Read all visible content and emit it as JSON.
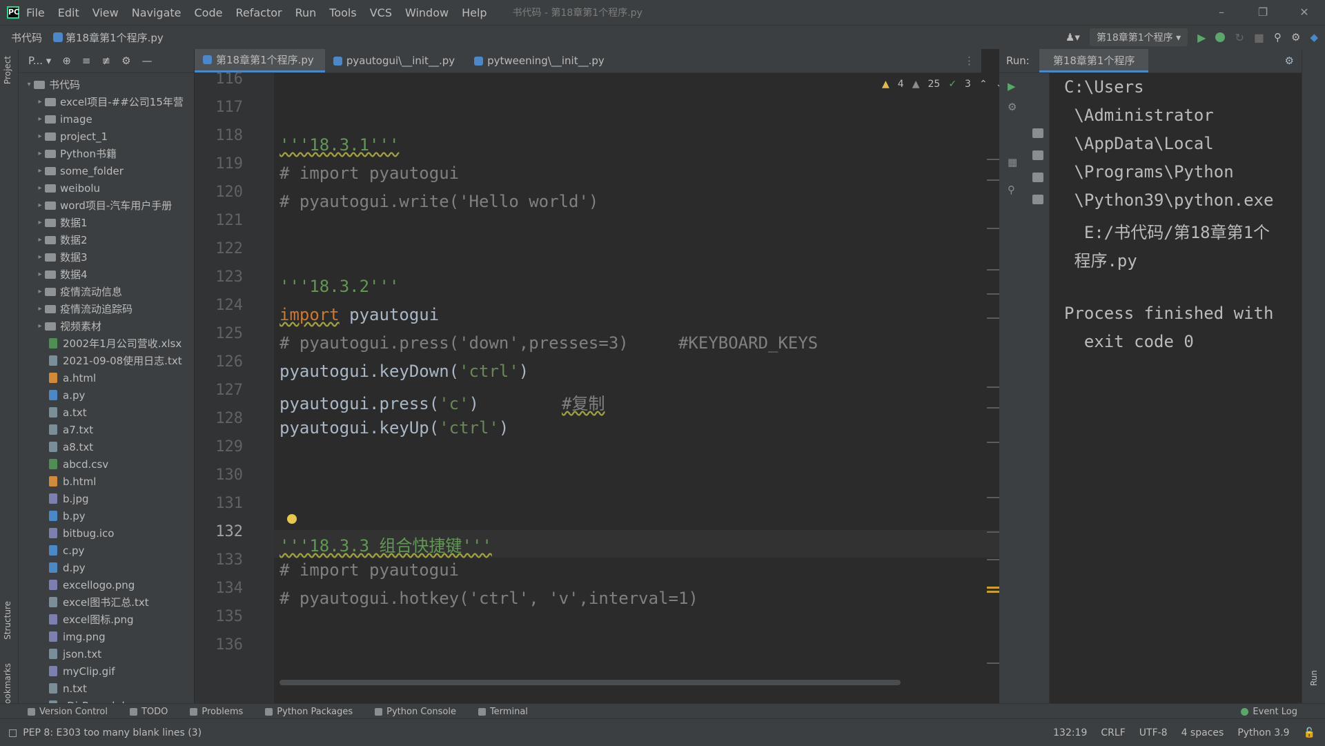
{
  "menubar": {
    "items": [
      "File",
      "Edit",
      "View",
      "Navigate",
      "Code",
      "Refactor",
      "Run",
      "Tools",
      "VCS",
      "Window",
      "Help"
    ],
    "title": "书代码 - 第18章第1个程序.py",
    "window_buttons": [
      "–",
      "❐",
      "✕"
    ]
  },
  "navbar": {
    "project": "书代码",
    "file": "第18章第1个程序.py",
    "run_config": "第18章第1个程序"
  },
  "project_panel": {
    "header": "P...",
    "tree": [
      {
        "type": "folder",
        "label": "书代码",
        "open": true,
        "root": true
      },
      {
        "type": "folder",
        "label": "excel项目-##公司15年营"
      },
      {
        "type": "folder",
        "label": "image"
      },
      {
        "type": "folder",
        "label": "project_1"
      },
      {
        "type": "folder",
        "label": "Python书籍"
      },
      {
        "type": "folder",
        "label": "some_folder"
      },
      {
        "type": "folder",
        "label": "weibolu"
      },
      {
        "type": "folder",
        "label": "word项目-汽车用户手册"
      },
      {
        "type": "folder",
        "label": "数据1"
      },
      {
        "type": "folder",
        "label": "数据2"
      },
      {
        "type": "folder",
        "label": "数据3"
      },
      {
        "type": "folder",
        "label": "数据4"
      },
      {
        "type": "folder",
        "label": "疫情流动信息"
      },
      {
        "type": "folder",
        "label": "疫情流动追踪码"
      },
      {
        "type": "folder",
        "label": "视频素材"
      },
      {
        "type": "xls",
        "label": "2002年1月公司营收.xlsx"
      },
      {
        "type": "txt",
        "label": "2021-09-08使用日志.txt"
      },
      {
        "type": "html",
        "label": "a.html"
      },
      {
        "type": "py",
        "label": "a.py"
      },
      {
        "type": "txt",
        "label": "a.txt"
      },
      {
        "type": "txt",
        "label": "a7.txt"
      },
      {
        "type": "txt",
        "label": "a8.txt"
      },
      {
        "type": "xls",
        "label": "abcd.csv"
      },
      {
        "type": "html",
        "label": "b.html"
      },
      {
        "type": "img",
        "label": "b.jpg"
      },
      {
        "type": "py",
        "label": "b.py"
      },
      {
        "type": "img",
        "label": "bitbug.ico"
      },
      {
        "type": "py",
        "label": "c.py"
      },
      {
        "type": "py",
        "label": "d.py"
      },
      {
        "type": "img",
        "label": "excellogo.png"
      },
      {
        "type": "txt",
        "label": "excel图书汇总.txt"
      },
      {
        "type": "img",
        "label": "excel图标.png"
      },
      {
        "type": "img",
        "label": "img.png"
      },
      {
        "type": "txt",
        "label": "json.txt"
      },
      {
        "type": "img",
        "label": "myClip.gif"
      },
      {
        "type": "txt",
        "label": "n.txt"
      },
      {
        "type": "txt",
        "label": "rDirRword.docx"
      }
    ]
  },
  "editor_tabs": [
    "第18章第1个程序.py",
    "pyautogui\\__init__.py",
    "pytweening\\__init__.py"
  ],
  "inspections": {
    "warnings": "4",
    "weak_warnings": "25",
    "typos": "3"
  },
  "gutter": [
    "116",
    "117",
    "118",
    "119",
    "120",
    "121",
    "122",
    "123",
    "124",
    "125",
    "126",
    "127",
    "128",
    "129",
    "130",
    "131",
    "132",
    "133",
    "134",
    "135",
    "136"
  ],
  "code": {
    "l118": "'''18.3.1'''",
    "l119": "# import pyautogui",
    "l120": "# pyautogui.write('Hello world')",
    "l123": "'''18.3.2'''",
    "l124_kw": "import",
    "l124_rest": " pyautogui",
    "l125": "# pyautogui.press('down',presses=3)     #KEYBOARD_KEYS",
    "l126_a": "pyautogui.keyDown(",
    "l126_s": "'ctrl'",
    "l126_b": ")",
    "l127_a": "pyautogui.press(",
    "l127_s": "'c'",
    "l127_b": ")",
    "l127_c": "#复制",
    "l128_a": "pyautogui.keyUp(",
    "l128_s": "'ctrl'",
    "l128_b": ")",
    "l132": "'''18.3.3 组合快捷键'''",
    "l133": "# import pyautogui",
    "l134": "# pyautogui.hotkey('ctrl', 'v',interval=1)"
  },
  "run_panel": {
    "label": "Run:",
    "tab": "第18章第1个程序",
    "console": [
      "C:\\Users",
      " \\Administrator",
      " \\AppData\\Local",
      " \\Programs\\Python",
      " \\Python39\\python.exe",
      "  E:/书代码/第18章第1个",
      " 程序.py",
      "",
      "Process finished with",
      "  exit code 0"
    ]
  },
  "left_stripe": {
    "project": "Project",
    "structure": "Structure",
    "bookmarks": "Bookmarks"
  },
  "right_stripe": {
    "run": "Run"
  },
  "bottom_tools": [
    "Version Control",
    "TODO",
    "Problems",
    "Python Packages",
    "Python Console",
    "Terminal"
  ],
  "event_log": "Event Log",
  "status": {
    "message": "PEP 8: E303 too many blank lines (3)",
    "position": "132:19",
    "line_sep": "CRLF",
    "encoding": "UTF-8",
    "indent": "4 spaces",
    "interpreter": "Python 3.9"
  }
}
